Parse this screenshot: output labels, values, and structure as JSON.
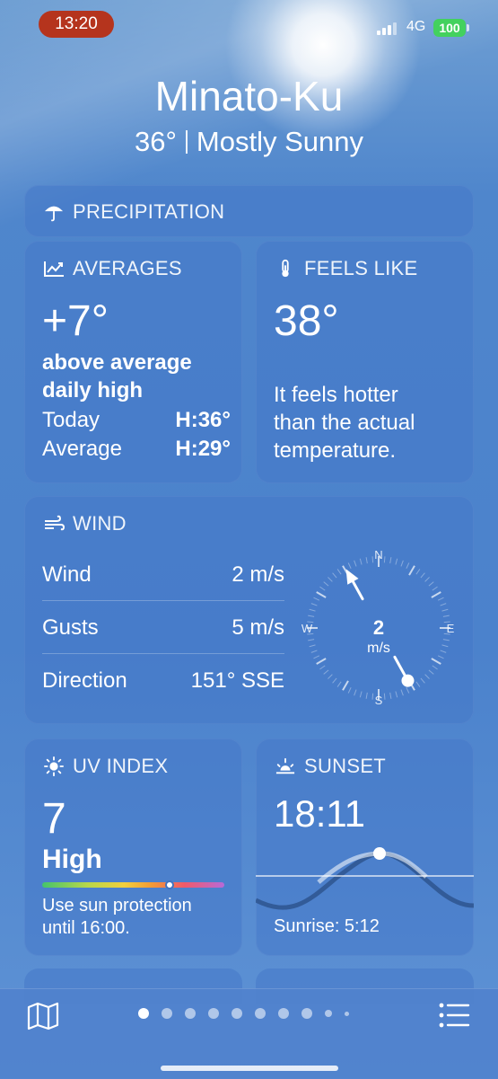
{
  "status_bar": {
    "time": "13:20",
    "network": "4G",
    "battery": "100"
  },
  "header": {
    "city": "Minato-Ku",
    "temperature": "36°",
    "condition": "Mostly Sunny"
  },
  "precipitation": {
    "title": "PRECIPITATION"
  },
  "averages": {
    "title": "AVERAGES",
    "value": "+7°",
    "desc_line1": "above average",
    "desc_line2": "daily high",
    "today_label": "Today",
    "today_value": "H:36°",
    "average_label": "Average",
    "average_value": "H:29°"
  },
  "feels_like": {
    "title": "FEELS LIKE",
    "value": "38°",
    "desc_line1": "It feels hotter",
    "desc_line2": "than the actual",
    "desc_line3": "temperature."
  },
  "wind": {
    "title": "WIND",
    "wind_label": "Wind",
    "wind_value": "2 m/s",
    "gusts_label": "Gusts",
    "gusts_value": "5 m/s",
    "direction_label": "Direction",
    "direction_value": "151° SSE",
    "compass": {
      "n": "N",
      "e": "E",
      "s": "S",
      "w": "W",
      "speed": "2",
      "unit": "m/s",
      "direction_degrees": 151
    }
  },
  "uv_index": {
    "title": "UV INDEX",
    "value": "7",
    "level": "High",
    "level_fraction": 0.7,
    "desc_line1": "Use sun protection",
    "desc_line2": "until 16:00."
  },
  "sunset": {
    "title": "SUNSET",
    "time": "18:11",
    "sunrise": "Sunrise: 5:12"
  },
  "pager": {
    "pages": 10,
    "active": 0
  }
}
